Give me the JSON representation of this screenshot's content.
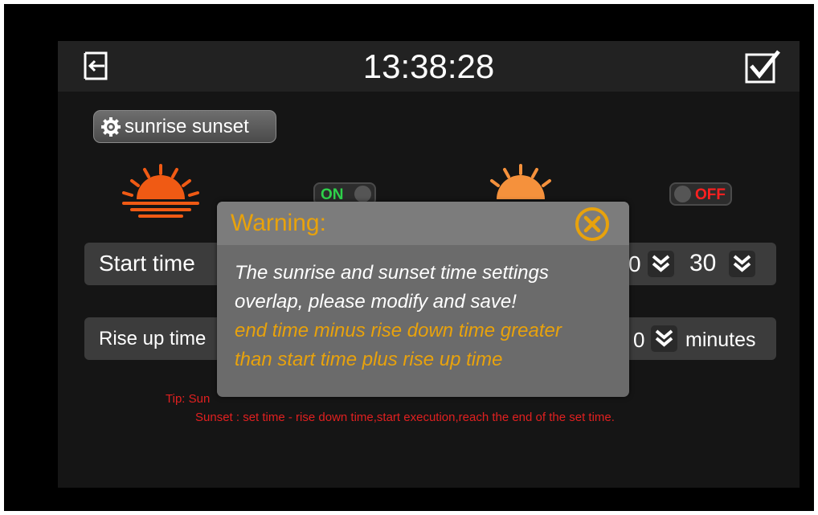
{
  "header": {
    "clock": "13:38:28",
    "exit_icon": "exit-icon",
    "confirm_icon": "checkbox-checked-icon"
  },
  "mode_button": {
    "label": "sunrise sunset",
    "icon": "gear-icon"
  },
  "sunrise": {
    "icon": "sunrise-icon",
    "toggle_label": "ON",
    "toggle_state": true,
    "color": "#f05a14"
  },
  "sunset": {
    "icon": "sunset-icon",
    "toggle_label": "OFF",
    "toggle_state": false,
    "color": "#f5913c"
  },
  "start_row": {
    "label": "Start time",
    "hour_partial": "0",
    "minute": "30",
    "dropdown_icon": "double-chevron-down-icon"
  },
  "rise_row": {
    "label": "Rise up time",
    "value_partial": "0",
    "unit": "minutes",
    "dropdown_icon": "double-chevron-down-icon"
  },
  "tips": {
    "line1_visible": "Tip: Sun",
    "line2": "Sunset : set time - rise down time,start execution,reach the end of the set time."
  },
  "dialog": {
    "title": "Warning:",
    "close_icon": "close-circle-icon",
    "message_lines": [
      "The sunrise and sunset time settings",
      "overlap, please modify and save!"
    ],
    "hint_lines": [
      "end time minus rise down time greater",
      "than start time plus rise up time"
    ],
    "accent_color": "#e8a20c"
  }
}
